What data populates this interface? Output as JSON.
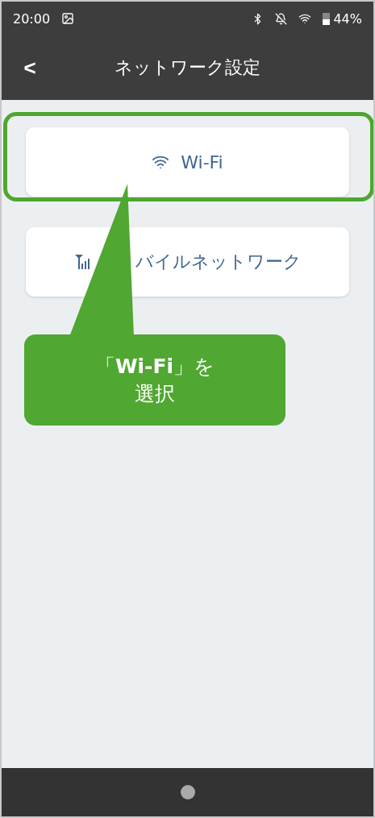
{
  "status_bar": {
    "time": "20:00",
    "battery_percent": "44%"
  },
  "header": {
    "back": "<",
    "title": "ネットワーク設定"
  },
  "options": [
    {
      "kind": "wifi",
      "label": "Wi-Fi"
    },
    {
      "kind": "mobile",
      "label": "バイルネットワーク"
    }
  ],
  "callout": {
    "lines": [
      "「**Wi-Fi**」を",
      "選択"
    ]
  }
}
